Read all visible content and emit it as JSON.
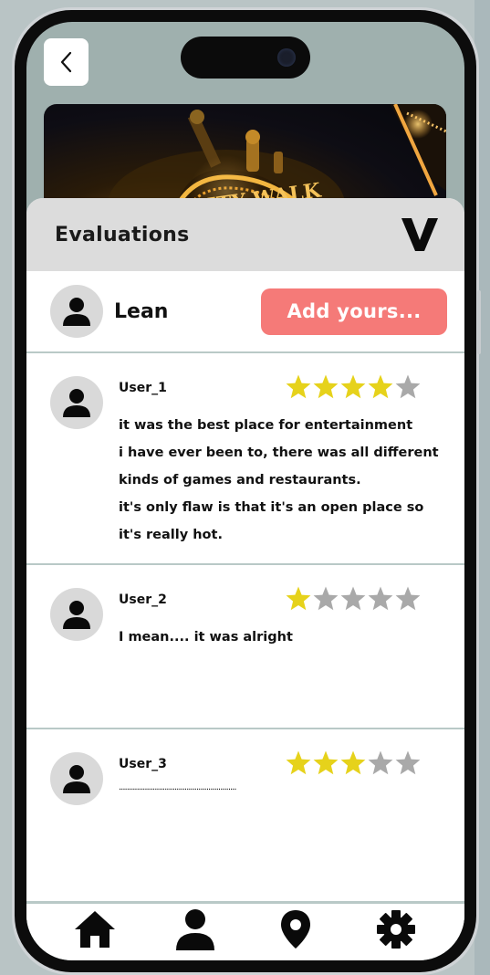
{
  "header": {
    "back_icon": "chevron-left-icon"
  },
  "sheet": {
    "title": "Evaluations",
    "collapse_icon": "chevron-down-icon"
  },
  "current_user": {
    "name": "Lean",
    "add_button_label": "Add yours..."
  },
  "reviews": [
    {
      "user": "User_1",
      "rating": 4,
      "max_rating": 5,
      "text": "it was the best place for entertainment\ni have ever been to, there was all different\nkinds of games and restaurants.\nit's only flaw  is that it's an open place so\nit's really hot."
    },
    {
      "user": "User_2",
      "rating": 1,
      "max_rating": 5,
      "text": "I mean.... it was alright"
    },
    {
      "user": "User_3",
      "rating": 3,
      "max_rating": 5,
      "text": "..........................................................."
    }
  ],
  "nav": {
    "items": [
      "home-icon",
      "profile-icon",
      "location-pin-icon",
      "settings-gear-icon"
    ]
  },
  "colors": {
    "star_filled": "#e6d21b",
    "star_empty": "#a9a9a9",
    "add_button": "#f57a78",
    "sheet_header": "#dcdcdc",
    "avatar_bg": "#d9d9d9"
  }
}
